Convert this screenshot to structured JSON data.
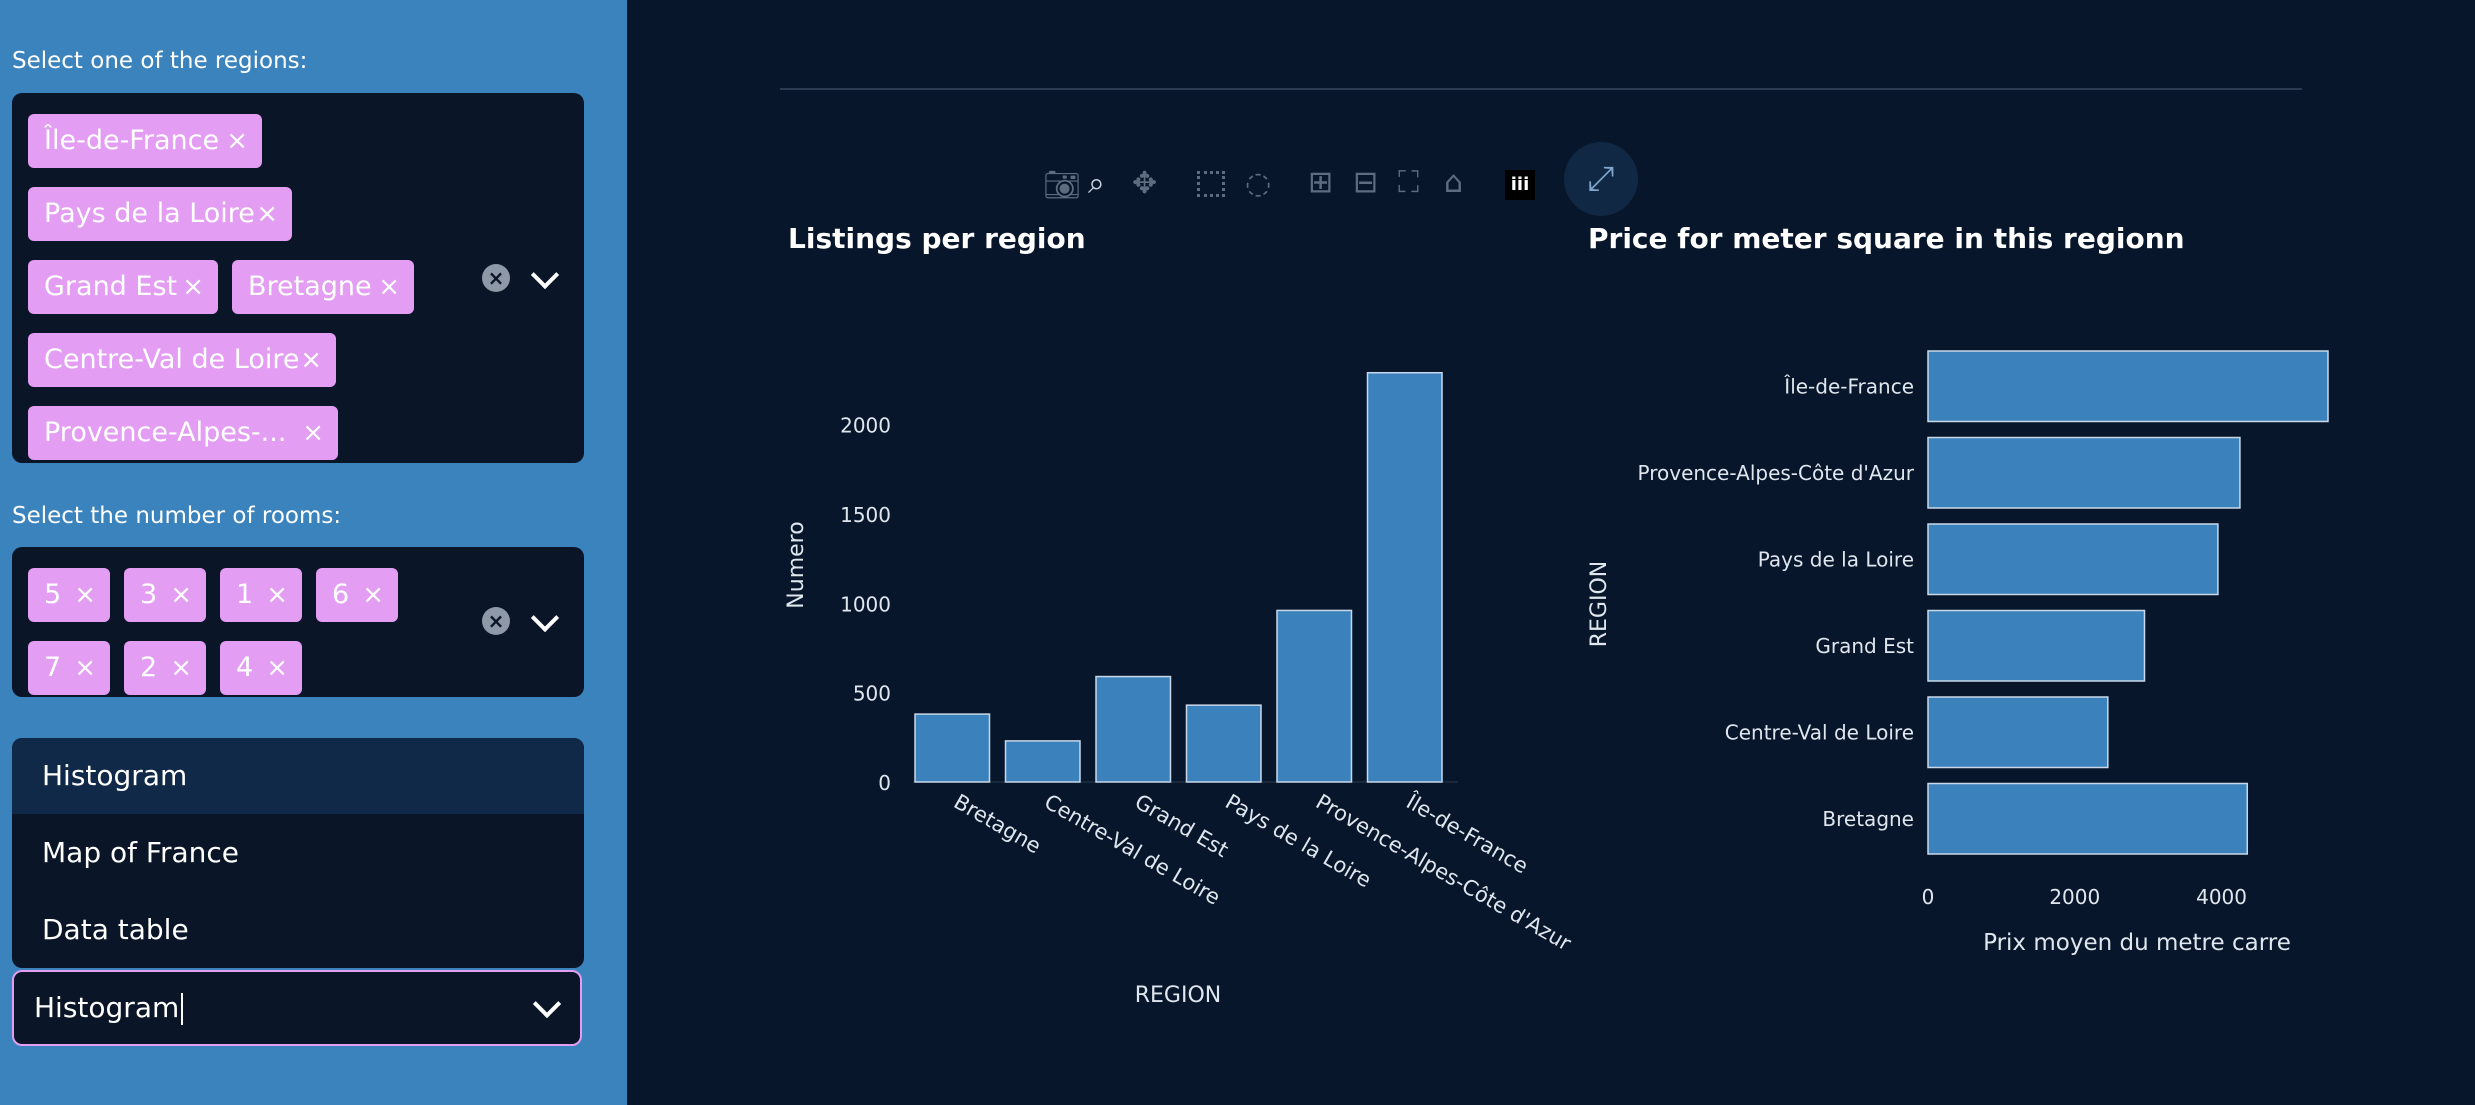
{
  "sidebar": {
    "regions_label": "Select one of the regions:",
    "region_chips": [
      "Île-de-France",
      "Pays de la Loire",
      "Grand Est",
      "Bretagne",
      "Centre-Val de Loire",
      "Provence-Alpes-..."
    ],
    "rooms_label": "Select the number of rooms:",
    "room_chips": [
      "5",
      "3",
      "1",
      "6",
      "7",
      "2",
      "4"
    ],
    "chip_remove": "×",
    "clear_glyph": "×",
    "dropdown_options": [
      "Histogram",
      "Map of France",
      "Data table"
    ],
    "selected_view": "Histogram"
  },
  "toolbar": {
    "icons": [
      "camera-icon",
      "zoom-icon",
      "pan-icon",
      "box-select-icon",
      "lasso-icon",
      "zoom-in-icon",
      "zoom-out-icon",
      "autoscale-icon",
      "reset-axes-icon",
      "plotly-logo-icon"
    ],
    "expand_icon": "fullscreen-icon"
  },
  "colors": {
    "bar": "#3b82bd",
    "bar_edge": "#c9d8e8",
    "sidebar": "#3b83bd",
    "chip": "#e39df3",
    "background": "#07162a"
  },
  "chart_data": [
    {
      "type": "bar",
      "title": "Listings per region",
      "xlabel": "REGION",
      "ylabel": "Numero",
      "categories": [
        "Bretagne",
        "Centre-Val de Loire",
        "Grand Est",
        "Pays de la Loire",
        "Provence-Alpes-Côte d'Azur",
        "Île-de-France"
      ],
      "values": [
        380,
        230,
        590,
        430,
        960,
        2290
      ],
      "yticks": [
        "0",
        "500",
        "1000",
        "1500",
        "2000"
      ],
      "ylim": [
        0,
        2350
      ]
    },
    {
      "type": "bar",
      "orientation": "horizontal",
      "title": "Price for meter square in this regionn",
      "xlabel": "Prix moyen du metre carre",
      "ylabel": "REGION",
      "categories": [
        "Bretagne",
        "Centre-Val de Loire",
        "Grand Est",
        "Pays de la Loire",
        "Provence-Alpes-Côte d'Azur",
        "Île-de-France"
      ],
      "values": [
        4350,
        2450,
        2950,
        3950,
        4250,
        5450
      ],
      "xticks": [
        "0",
        "2000",
        "4000"
      ],
      "xlim": [
        0,
        5450
      ]
    }
  ]
}
